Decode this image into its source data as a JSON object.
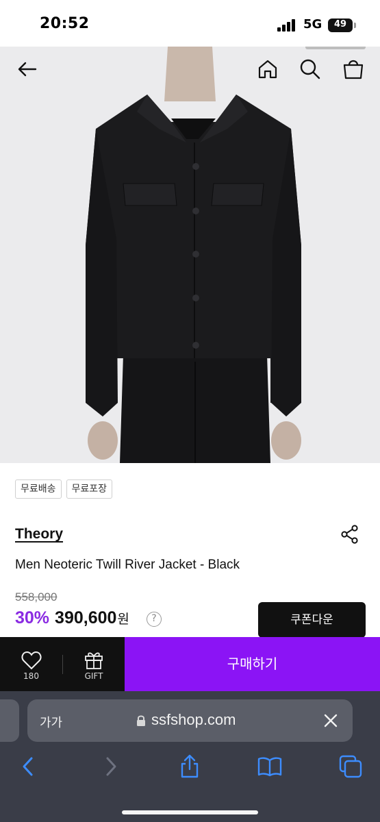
{
  "status_bar": {
    "time": "20:52",
    "network": "5G",
    "battery": "49"
  },
  "product": {
    "tags": [
      "무료배송",
      "무료포장"
    ],
    "brand": "Theory",
    "name": "Men Neoteric Twill River Jacket - Black",
    "original_price": "558,000",
    "discount": "30%",
    "price": "390,600",
    "currency": "원",
    "help_symbol": "?"
  },
  "buttons": {
    "coupon": "쿠폰다운",
    "buy": "구매하기"
  },
  "action_bar": {
    "like_count": "180",
    "gift_label": "GIFT"
  },
  "browser": {
    "text_size": "가가",
    "url": "ssfshop.com"
  },
  "icons": {
    "back": "arrow-left-icon",
    "home": "home-icon",
    "search": "search-icon",
    "bag": "shopping-bag-icon",
    "share": "share-icon",
    "heart": "heart-icon",
    "gift": "gift-icon",
    "lock": "lock-icon",
    "close": "close-icon",
    "browser_back": "chevron-left-icon",
    "browser_forward": "chevron-right-icon",
    "browser_share": "share-up-icon",
    "bookmarks": "book-icon",
    "tabs": "tabs-icon"
  },
  "colors": {
    "accent": "#8b14f5",
    "discount": "#8a2be2",
    "dark": "#111111",
    "browser": "#3a3d48"
  }
}
